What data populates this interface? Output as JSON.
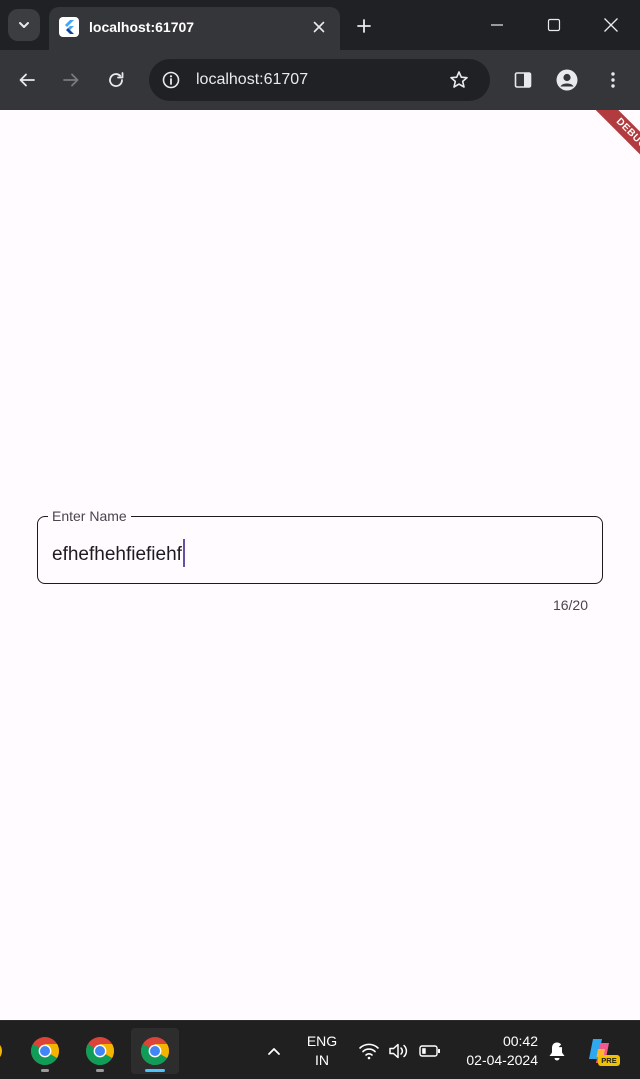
{
  "browser": {
    "tab": {
      "title": "localhost:61707",
      "favicon": "flutter-logo-icon"
    },
    "omnibox": {
      "url": "localhost:61707"
    }
  },
  "app": {
    "debug_banner": "DEBUG",
    "name_field": {
      "label": "Enter Name",
      "value": "efhefhehfiefiehf",
      "counter": "16/20",
      "length": 16,
      "max_length": 20
    }
  },
  "taskbar": {
    "language": {
      "line1": "ENG",
      "line2": "IN"
    },
    "clock": {
      "time": "00:42",
      "date": "02-04-2024"
    },
    "copilot_badge": "PRE"
  },
  "colors": {
    "content_bg": "#fffbfe",
    "field_border": "#1d1b20",
    "caret": "#6750a4",
    "debug_ribbon": "#b13b3e",
    "taskbar_active_indicator": "#4cc2ff"
  }
}
